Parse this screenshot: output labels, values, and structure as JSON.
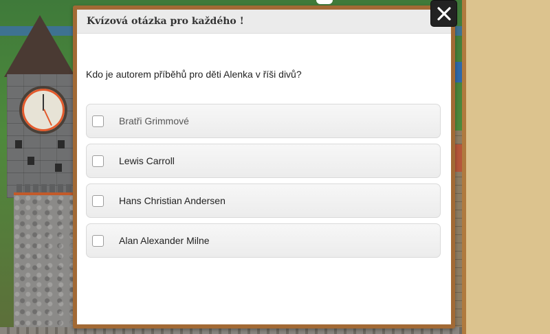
{
  "modal": {
    "title": "Kvízová otázka pro každého !",
    "close_icon": "close-icon",
    "question": "Kdo je autorem příběhů pro děti Alenka v říši divů?",
    "answers": [
      {
        "label": "Bratři Grimmové",
        "checked": false
      },
      {
        "label": "Lewis Carroll",
        "checked": false
      },
      {
        "label": "Hans Christian Andersen",
        "checked": false
      },
      {
        "label": "Alan Alexander Milne",
        "checked": false
      }
    ]
  },
  "colors": {
    "modal_frame": "#a26a35",
    "header_bg": "#ebebeb",
    "outer_bg": "#dcc38e",
    "close_bg": "#222222"
  }
}
